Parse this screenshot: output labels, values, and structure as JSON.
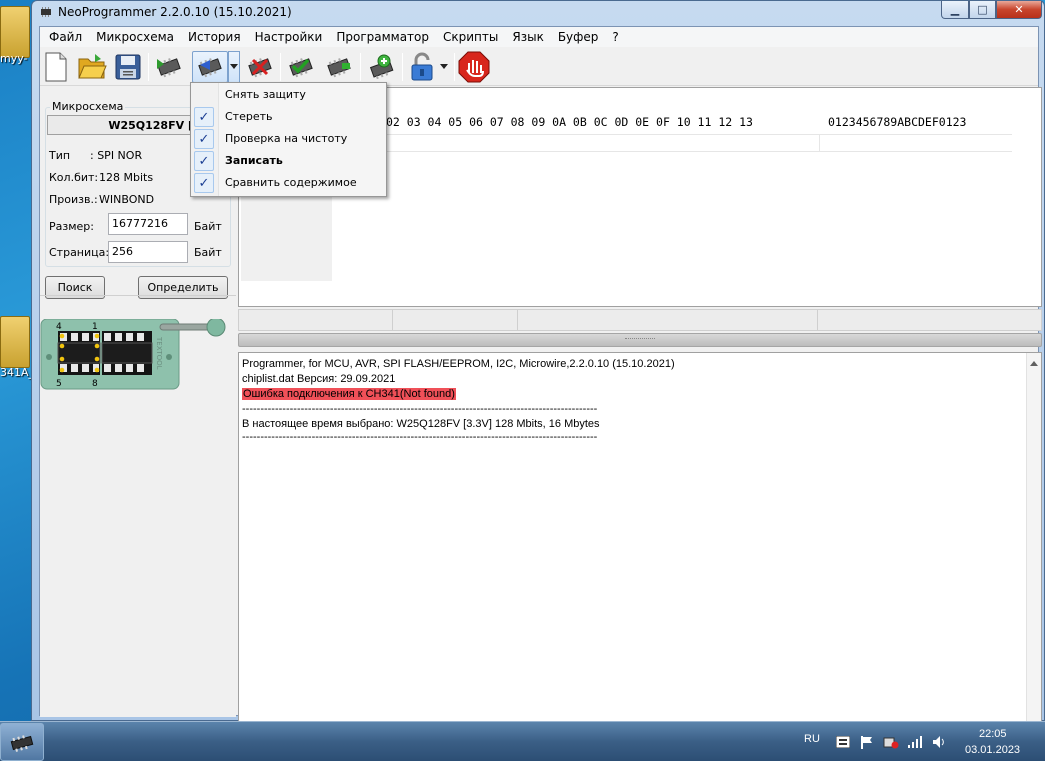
{
  "desktop": {
    "icon1_label": "myy-",
    "icon2_label": "341A_"
  },
  "window": {
    "title": "NeoProgrammer 2.2.0.10 (15.10.2021)",
    "min_glyph": "▁",
    "max_glyph": "□",
    "close_glyph": "✕"
  },
  "menu": [
    "Файл",
    "Микросхема",
    "История",
    "Настройки",
    "Программатор",
    "Скрипты",
    "Язык",
    "Буфер",
    "?"
  ],
  "chip_panel": {
    "group_title": "Микросхема",
    "chip_name": "W25Q128FV [3.3V]",
    "type_label": "Тип",
    "type_value": ": SPI NOR",
    "bits_label": "Кол.бит:",
    "bits_value": "128 Mbits",
    "maker_label": "Произв.:",
    "maker_value": "WINBOND",
    "size_label": "Размер:",
    "size_value": "16777216",
    "size_unit": "Байт",
    "page_label": "Страница:",
    "page_value": "256",
    "page_unit": "Байт",
    "search_button": "Поиск",
    "detect_button": "Определить",
    "pin_labels": [
      "4",
      "1",
      "5",
      "8"
    ],
    "socket_text": "TEXTOOL"
  },
  "hex": {
    "header_bytes": "02 03 04 05 06 07 08 09 0A 0B 0C 0D 0E 0F 10 11 12 13",
    "header_ascii": "0123456789ABCDEF0123"
  },
  "dropdown": {
    "items": [
      {
        "label": "Снять защиту",
        "checked": false
      },
      {
        "label": "Стереть",
        "checked": true
      },
      {
        "label": "Проверка на чистоту",
        "checked": true
      },
      {
        "label": "Записать",
        "checked": true
      },
      {
        "label": "Сравнить содержимое",
        "checked": true
      }
    ],
    "check_glyph": "✓"
  },
  "log": {
    "lines": [
      "Programmer, for MCU, AVR, SPI FLASH/EEPROM, I2C, Microwire,2.2.0.10 (15.10.2021)",
      "chiplist.dat Версия: 29.09.2021",
      "Ошибка подключения к CH341(Not found)",
      "-------------------------------------------------------------------------------------------------",
      "В настоящее время выбрано:  W25Q128FV [3.3V] 128 Mbits, 16 Mbytes",
      "-------------------------------------------------------------------------------------------------"
    ],
    "error_color": "#f05058"
  },
  "taskbar": {
    "language": "RU",
    "time": "22:05",
    "date": "03.01.2023"
  }
}
